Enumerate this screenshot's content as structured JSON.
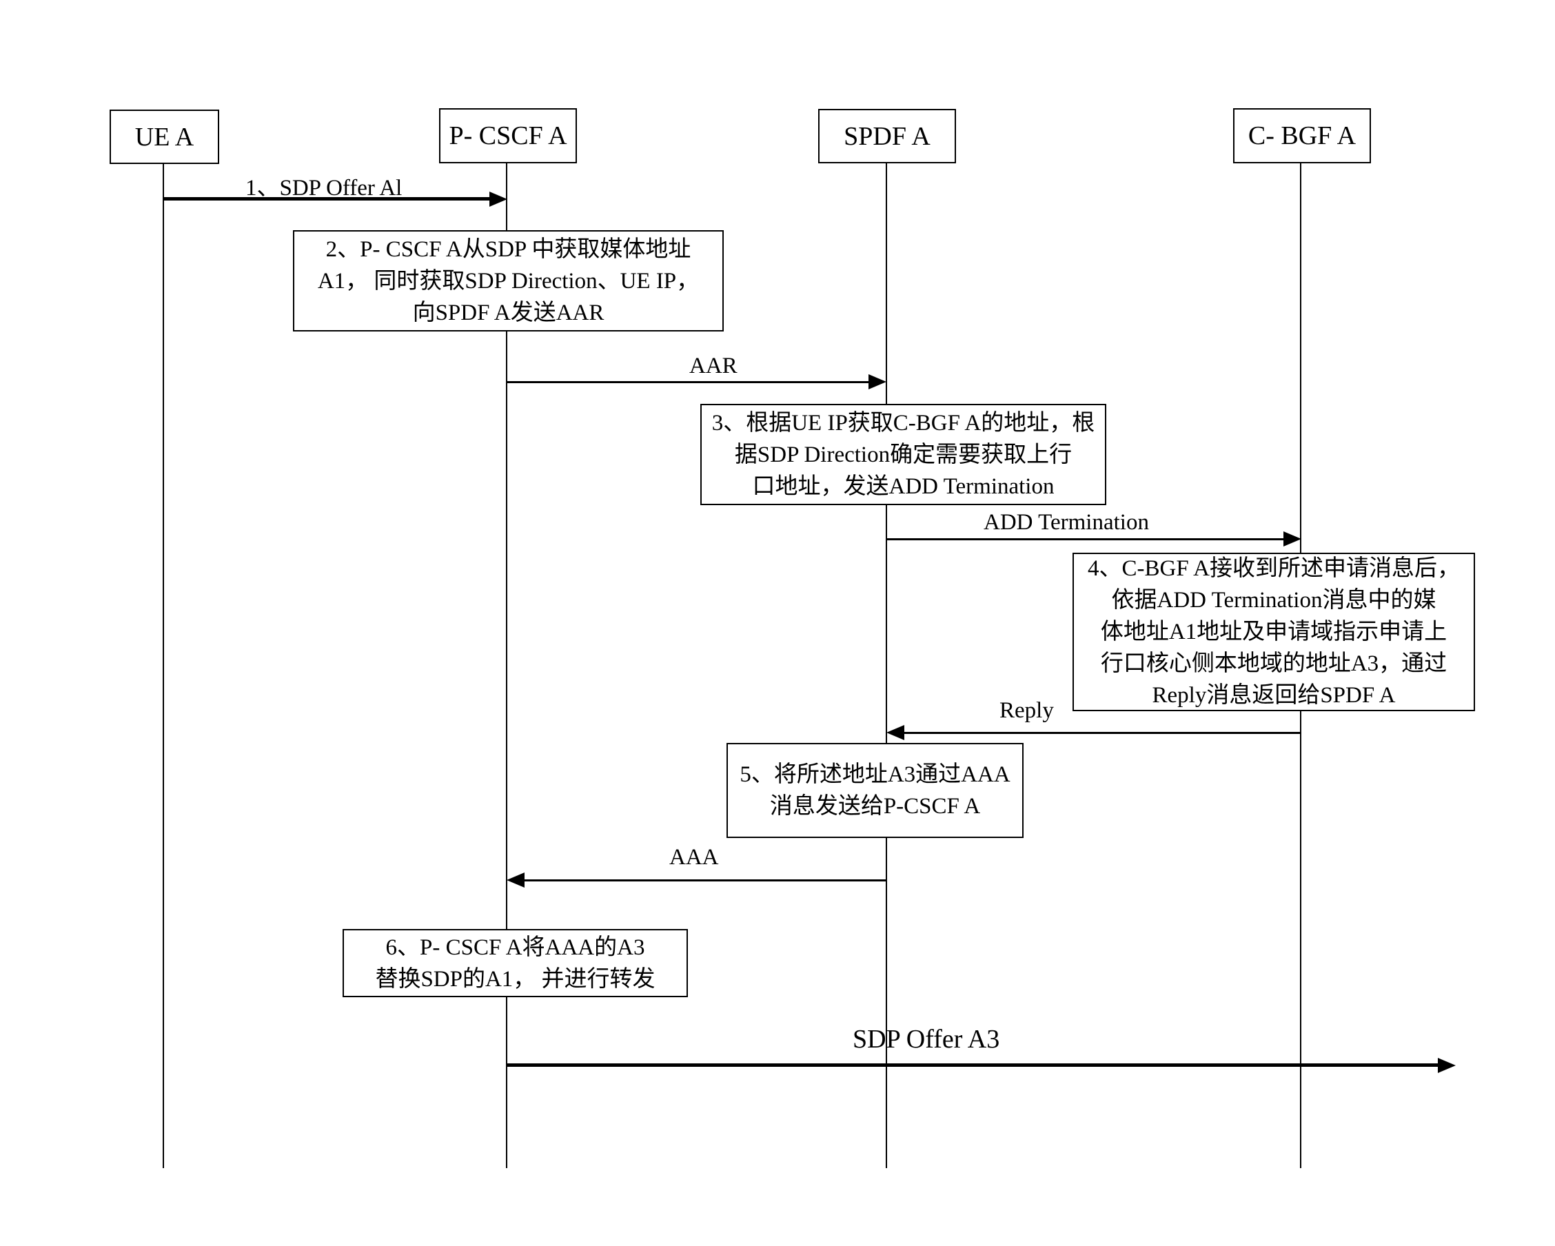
{
  "entities": [
    {
      "id": "ue-a",
      "label": "UE A"
    },
    {
      "id": "p-cscf-a",
      "label": "P- CSCF A"
    },
    {
      "id": "spdf-a",
      "label": "SPDF A"
    },
    {
      "id": "c-bgf-a",
      "label": "C- BGF A"
    }
  ],
  "messages": [
    {
      "label": "1、SDP Offer Al",
      "from": "UE A",
      "to": "P- CSCF A"
    },
    {
      "label": "AAR",
      "from": "P- CSCF A",
      "to": "SPDF A"
    },
    {
      "label": "ADD Termination",
      "from": "SPDF A",
      "to": "C- BGF A"
    },
    {
      "label": "Reply",
      "from": "C- BGF A",
      "to": "SPDF A"
    },
    {
      "label": "AAA",
      "from": "SPDF A",
      "to": "P- CSCF A"
    },
    {
      "label": "SDP Offer A3",
      "from": "P- CSCF A",
      "to": "outside"
    }
  ],
  "notes": [
    {
      "step": 2,
      "lines": [
        "2、P- CSCF A从SDP  中获取媒体地址",
        "A1，  同时获取SDP Direction、UE IP，",
        "向SPDF A发送AAR"
      ]
    },
    {
      "step": 3,
      "lines": [
        "3、根据UE IP获取C-BGF A的地址，根",
        "据SDP Direction确定需要获取上行",
        "口地址，发送ADD Termination"
      ]
    },
    {
      "step": 4,
      "lines": [
        "4、C-BGF A接收到所述申请消息后，",
        "依据ADD Termination消息中的媒",
        "体地址A1地址及申请域指示申请上",
        "行口核心侧本地域的地址A3，通过",
        "Reply消息返回给SPDF A"
      ]
    },
    {
      "step": 5,
      "lines": [
        "5、将所述地址A3通过AAA",
        "消息发送给P-CSCF A"
      ]
    },
    {
      "step": 6,
      "lines": [
        "6、P- CSCF A将AAA的A3",
        "替换SDP的A1，  并进行转发"
      ]
    }
  ]
}
